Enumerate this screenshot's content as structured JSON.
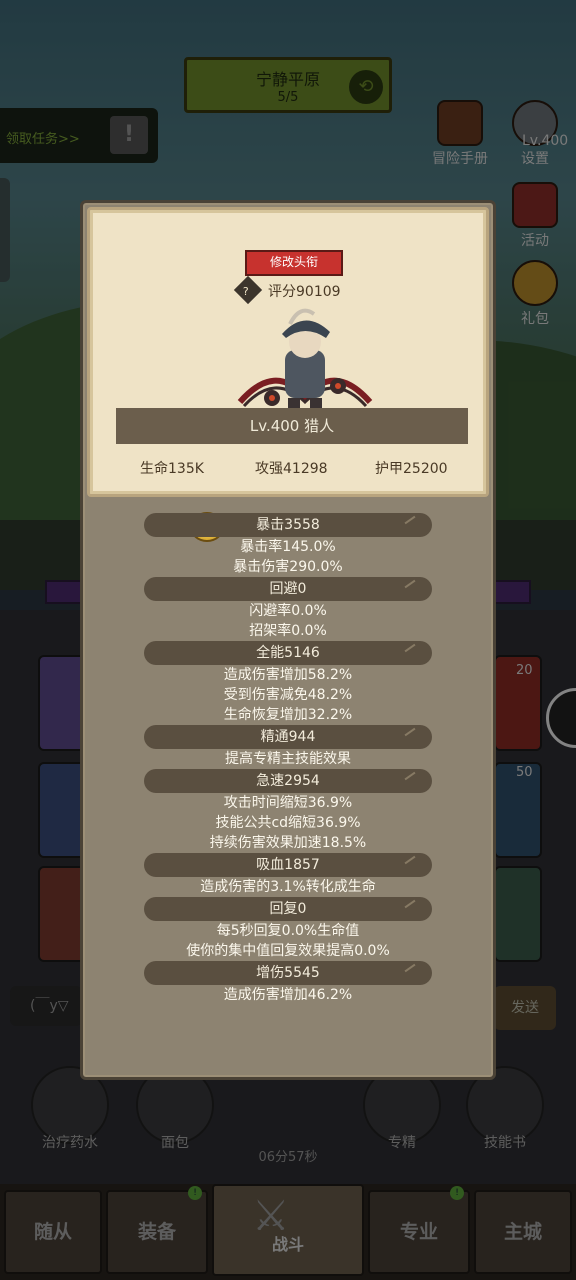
{
  "hud": {
    "quest_title": "宁静平原",
    "quest_progress": "5/5",
    "task_button": "领取任务>>",
    "adventure_manual": "冒险手册",
    "settings": "设置",
    "level_badge": "Lv.400",
    "activity": "活动",
    "gift": "礼包"
  },
  "panel": {
    "change_title_button": "修改头衔",
    "score_label": "评分90109",
    "name": "Lv.400 猎人",
    "hp": "生命135K",
    "attack": "攻强41298",
    "armor": "护甲25200",
    "stats": [
      {
        "header": "暴击3558",
        "lines": [
          "暴击率145.0%",
          "暴击伤害290.0%"
        ]
      },
      {
        "header": "回避0",
        "lines": [
          "闪避率0.0%",
          "招架率0.0%"
        ]
      },
      {
        "header": "全能5146",
        "lines": [
          "造成伤害增加58.2%",
          "受到伤害减免48.2%",
          "生命恢复增加32.2%"
        ]
      },
      {
        "header": "精通944",
        "lines": [
          "提高专精主技能效果"
        ]
      },
      {
        "header": "急速2954",
        "lines": [
          "攻击时间缩短36.9%",
          "技能公共cd缩短36.9%",
          "持续伤害效果加速18.5%"
        ]
      },
      {
        "header": "吸血1857",
        "lines": [
          "造成伤害的3.1%转化成生命"
        ]
      },
      {
        "header": "回复0",
        "lines": [
          "每5秒回复0.0%生命值",
          "使你的集中值回复效果提高0.0%"
        ]
      },
      {
        "header": "增伤5545",
        "lines": [
          "造成伤害增加46.2%"
        ]
      }
    ]
  },
  "background": {
    "slot_counts": [
      "20",
      "50"
    ],
    "chat_placeholder": "(￣y▽",
    "send": "发送"
  },
  "bottom_items": [
    "治疗药水",
    "面包",
    "专精",
    "技能书"
  ],
  "timer": "06分57秒",
  "nav": {
    "companions": "随从",
    "equipment": "装备",
    "battle": "战斗",
    "profession": "专业",
    "main_city": "主城"
  },
  "colors": {
    "panel_bg": "#8d8371",
    "parchment": "#efe3c6",
    "title_button": "#c7322e",
    "stat_header": "#5a4f40"
  }
}
